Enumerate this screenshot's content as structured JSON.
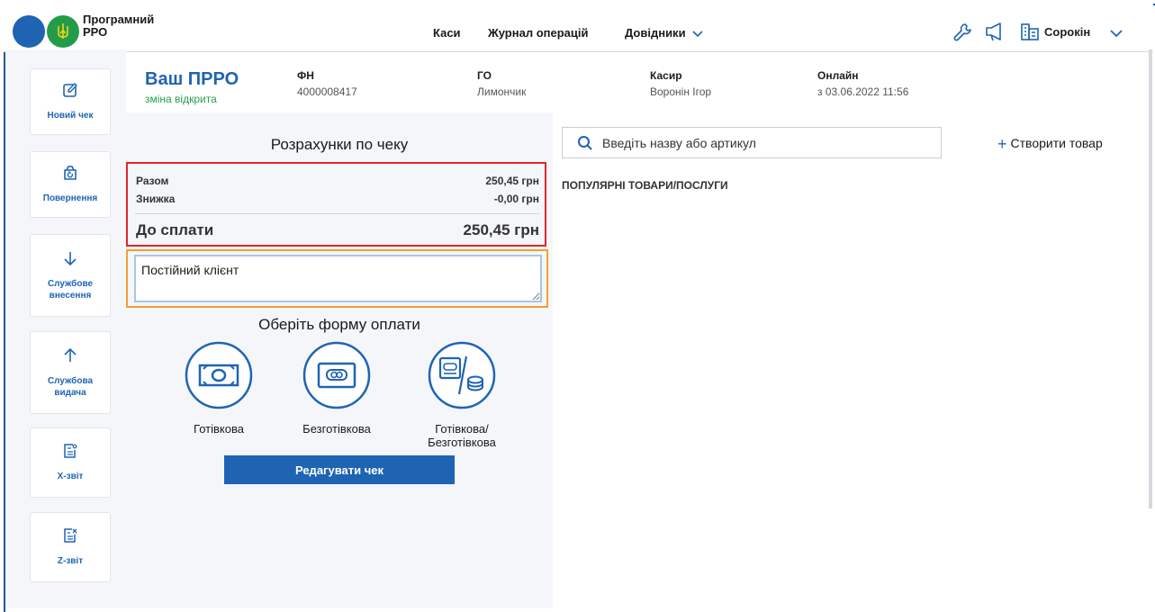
{
  "header": {
    "brand": "Програмний РРО",
    "nav": {
      "kasy": "Каси",
      "journal": "Журнал операцій",
      "references": "Довідники"
    },
    "user": "Сорокін"
  },
  "sidebar": {
    "items": [
      {
        "label": "Новий чек",
        "icon": "edit-icon"
      },
      {
        "label": "Повернення",
        "icon": "return-icon"
      },
      {
        "label": "Службове внесення",
        "icon": "arrow-down-icon"
      },
      {
        "label": "Службова видача",
        "icon": "arrow-up-icon"
      },
      {
        "label": "X-звіт",
        "icon": "x-report-icon"
      },
      {
        "label": "Z-звіт",
        "icon": "z-report-icon"
      }
    ]
  },
  "shift": {
    "title": "Ваш ПРРО",
    "status": "зміна відкрита",
    "fn_label": "ФН",
    "fn_value": "4000008417",
    "go_label": "ГО",
    "go_value": "Лимончик",
    "cashier_label": "Касир",
    "cashier_value": "Воронін Ігор",
    "online_label": "Онлайн",
    "online_value": "з 03.06.2022 11:56"
  },
  "receipt": {
    "title": "Розрахунки по чеку",
    "total_label": "Разом",
    "total_value": "250,45 грн",
    "discount_label": "Знижка",
    "discount_value": "-0,00 грн",
    "to_pay_label": "До сплати",
    "to_pay_value": "250,45 грн",
    "client_input_value": "Постійний клієнт",
    "payment_title": "Оберіть форму оплати",
    "payment_options": [
      {
        "label": "Готівкова",
        "icon": "cash-icon"
      },
      {
        "label": "Безготівкова",
        "icon": "card-icon"
      },
      {
        "label_line1": "Готівкова/",
        "label_line2": "Безготівкова",
        "icon": "mixed-payment-icon"
      }
    ],
    "edit_button": "Редагувати чек"
  },
  "catalog": {
    "search_placeholder": "Введіть назву або артикул",
    "create_button": "Створити товар",
    "popular_title": "ПОПУЛЯРНІ ТОВАРИ/ПОСЛУГИ"
  },
  "colors": {
    "accent": "#1f64b3",
    "success": "#26a04f",
    "highlight_red": "#e0262b",
    "highlight_orange": "#f0a030"
  }
}
